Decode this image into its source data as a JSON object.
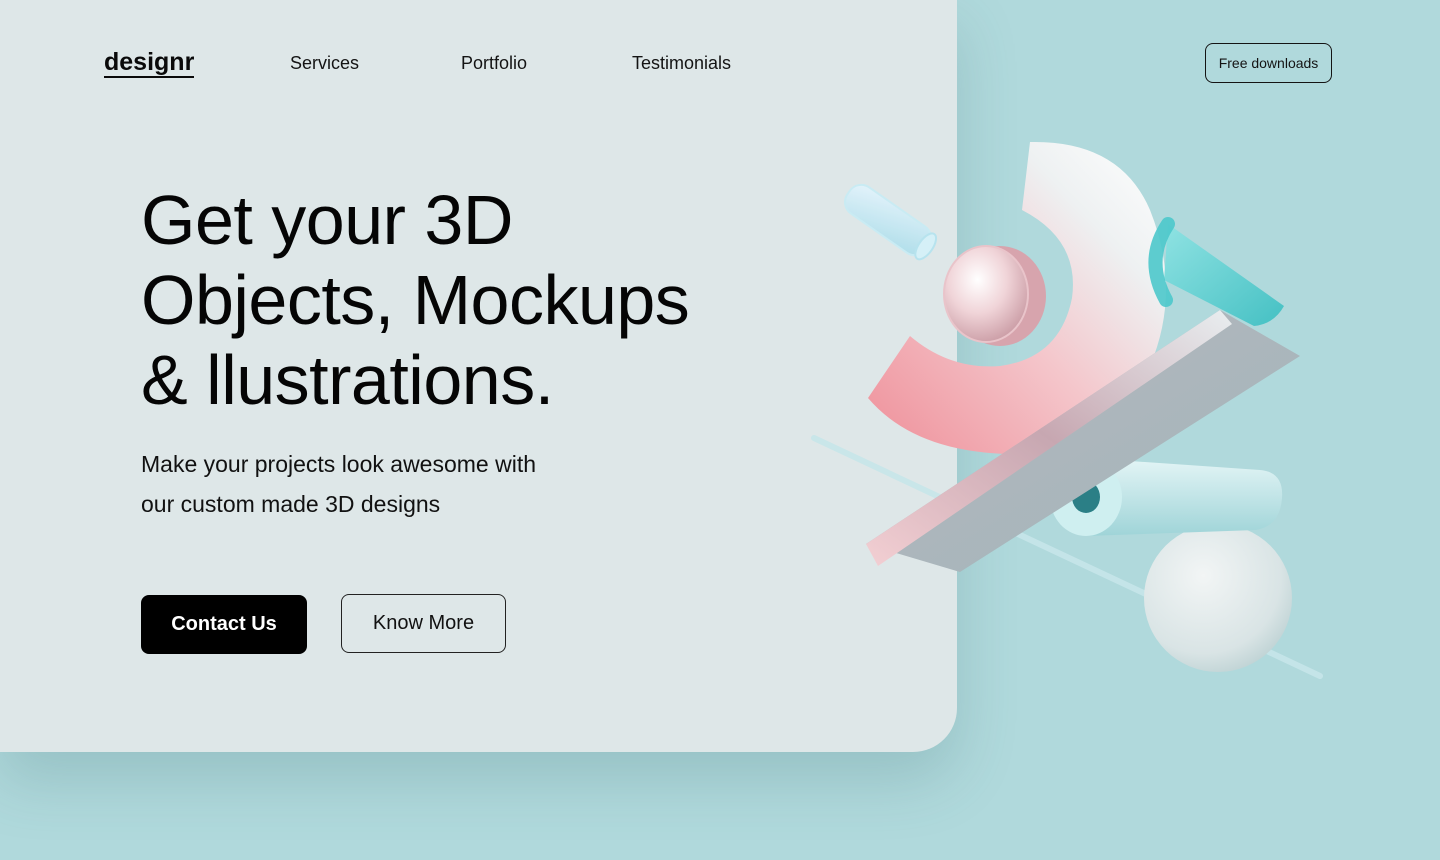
{
  "nav": {
    "logo": "designr",
    "links": [
      "Services",
      "Portfolio",
      "Testimonials"
    ],
    "cta": "Free downloads"
  },
  "hero": {
    "headline_lines": [
      "Get your 3D",
      "Objects, Mockups",
      "& llustrations."
    ],
    "subtitle_lines": [
      "Make your projects look awesome with",
      "our custom made 3D designs"
    ],
    "primary_button": "Contact Us",
    "secondary_button": "Know More"
  },
  "illustration": {
    "description_icon": "3d-shapes-illustration"
  },
  "colors": {
    "page_background": "#b0d9dc",
    "panel_background": "#dee7e8",
    "primary_button_bg": "#000000",
    "text": "#0a0a0a",
    "accent_pink": "#ef9aa3",
    "accent_teal": "#5cc9cb"
  }
}
